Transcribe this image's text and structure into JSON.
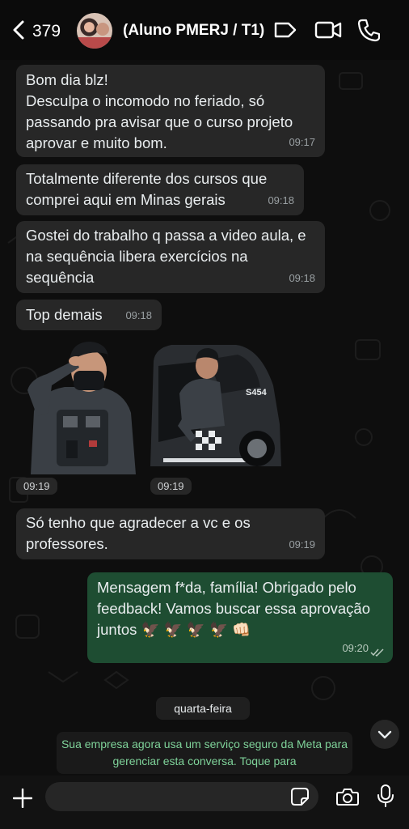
{
  "header": {
    "back_count": "379",
    "contact_name": "(Aluno PMERJ / T1)",
    "icons": [
      "chevron-left-icon",
      "avatar",
      "label-tag-icon",
      "video-call-icon",
      "phone-icon"
    ]
  },
  "messages": [
    {
      "direction": "in",
      "text": "Bom dia blz!\nDesculpa o incomodo no feriado, só passando pra avisar que o curso projeto aprovar e muito bom.",
      "time": "09:17"
    },
    {
      "direction": "in",
      "text": "Totalmente diferente dos cursos que comprei aqui em Minas gerais",
      "time": "09:18"
    },
    {
      "direction": "in",
      "text": "Gostei do trabalho q passa a video aula, e na sequência libera exercícios na sequência",
      "time": "09:18"
    },
    {
      "direction": "in",
      "text": "Top demais",
      "time": "09:18"
    },
    {
      "direction": "in",
      "type": "sticker",
      "content": "saluting police officer",
      "time": "09:19"
    },
    {
      "direction": "in",
      "type": "sticker",
      "content": "police officer leaning out of patrol car",
      "vehicle_text": "S454",
      "time": "09:19"
    },
    {
      "direction": "in",
      "text": "Só tenho que agradecer a vc e os professores.",
      "time": "09:19"
    },
    {
      "direction": "out",
      "text": "Mensagem f*da, família! Obrigado pelo feedback! Vamos buscar essa aprovação juntos 🦅 🦅 🦅 🦅 👊🏻",
      "time": "09:20",
      "status": "read"
    }
  ],
  "day_separator": "quarta-feira",
  "system_notice": "Sua empresa agora usa um serviço seguro da Meta para gerenciar esta conversa. Toque para",
  "composer": {
    "placeholder": "",
    "icons": [
      "plus-icon",
      "sticker-icon",
      "camera-icon",
      "microphone-icon"
    ]
  },
  "colors": {
    "incoming_bubble": "#272727",
    "outgoing_bubble": "#1e4d32",
    "system_text": "#7fd39a",
    "background": "#0e0e0e"
  }
}
